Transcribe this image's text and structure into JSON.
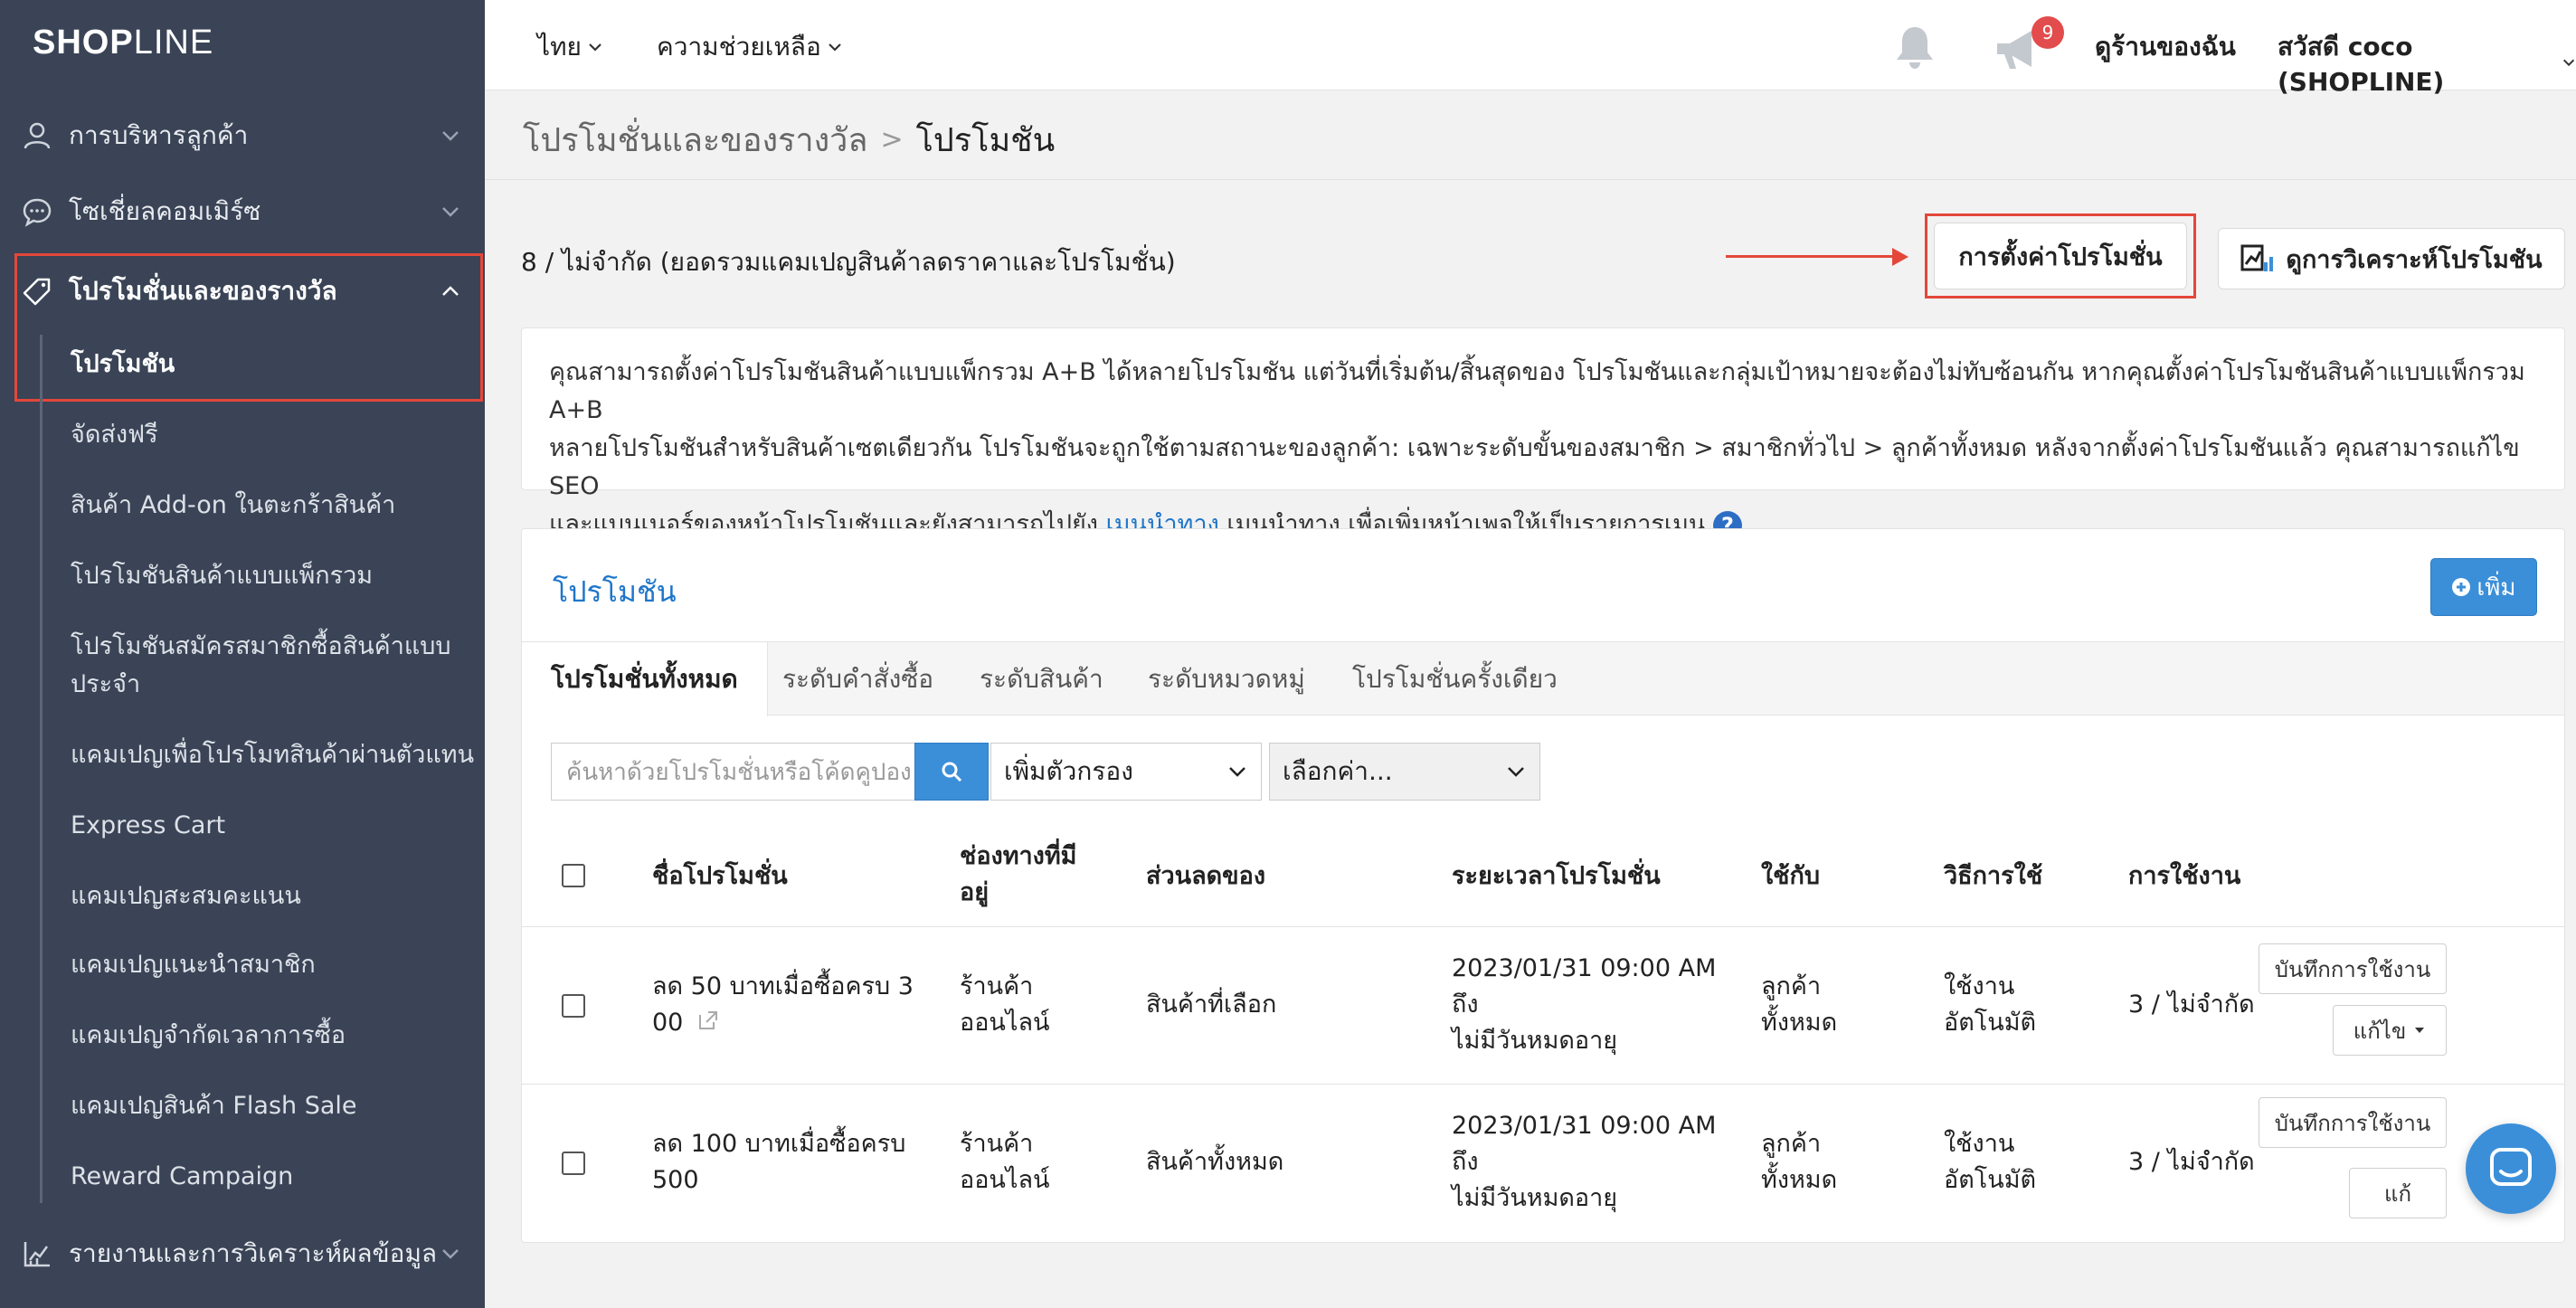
{
  "sidebar": {
    "logo_bold": "SHOP",
    "logo_thin": "LINE",
    "groups": [
      {
        "label": "การบริหารลูกค้า",
        "icon": "user-icon"
      },
      {
        "label": "โซเชี่ยลคอมเมิร์ซ",
        "icon": "chat-icon"
      },
      {
        "label": "โปรโมชั่นและของรางวัล",
        "icon": "tag-icon"
      },
      {
        "label": "รายงานและการวิเคราะห์ผลข้อมูล",
        "icon": "analytics-icon"
      }
    ],
    "sub_items": [
      "โปรโมชัน",
      "จัดส่งฟรี",
      "สินค้า Add-on ในตะกร้าสินค้า",
      "โปรโมชันสินค้าแบบแพ็กรวม",
      "โปรโมชันสมัครสมาชิกซื้อสินค้าแบบประจำ",
      "แคมเปญเพื่อโปรโมทสินค้าผ่านตัวแทน",
      "Express Cart",
      "แคมเปญสะสมคะแนน",
      "แคมเปญแนะนำสมาชิก",
      "แคมเปญจำกัดเวลาการซื้อ",
      "แคมเปญสินค้า Flash Sale",
      "Reward Campaign"
    ]
  },
  "topbar": {
    "language": "ไทย",
    "help": "ความช่วยเหลือ",
    "notification_count": "9",
    "view_store": "ดูร้านของฉัน",
    "greeting": "สวัสดี coco (SHOPLINE)"
  },
  "breadcrumb": {
    "parent": "โปรโมชั่นและของรางวัล",
    "separator": ">",
    "current": "โปรโมชัน"
  },
  "summary": {
    "quota": "8 / ไม่จำกัด (ยอดรวมแคมเปญสินค้าลดราคาและโปรโมชั่น)",
    "settings_button": "การตั้งค่าโปรโมชั่น",
    "analysis_button": "ดูการวิเคราะห์โปรโมชัน"
  },
  "info": {
    "line1": "คุณสามารถตั้งค่าโปรโมชันสินค้าแบบแพ็กรวม A+B ได้หลายโปรโมชัน แต่วันที่เริ่มต้น/สิ้นสุดของ โปรโมชันและกลุ่มเป้าหมายจะต้องไม่ทับซ้อนกัน หากคุณตั้งค่าโปรโมชันสินค้าแบบแพ็กรวม A+B",
    "line2": "หลายโปรโมชันสำหรับสินค้าเซตเดียวกัน โปรโมชันจะถูกใช้ตามสถานะของลูกค้า: เฉพาะระดับขั้นของสมาชิก > สมาชิกทั่วไป > ลูกค้าทั้งหมด หลังจากตั้งค่าโปรโมชันแล้ว คุณสามารถแก้ไข SEO",
    "line3_pre": "และแบนเนอร์ของหน้าโปรโมชันและยังสามารถไปยัง ",
    "line3_link": "เมนูนำทาง",
    "line3_post": " เมนูนำทาง เพื่อเพิ่มหน้าเพจให้เป็นรายการเมนู ",
    "help_mark": "?"
  },
  "panel": {
    "title": "โปรโมชัน",
    "add_button": "เพิ่ม",
    "tabs": [
      "โปรโมชั่นทั้งหมด",
      "ระดับคำสั่งซื้อ",
      "ระดับสินค้า",
      "ระดับหมวดหมู่",
      "โปรโมชั่นครั้งเดียว"
    ],
    "search_placeholder": "ค้นหาด้วยโปรโมชั่นหรือโค้ดคูปอง",
    "filter_select": "เพิ่มตัวกรอง",
    "value_select": "เลือกค่า...",
    "columns": {
      "name": "ชื่อโปรโมชั่น",
      "channel_1": "ช่องทางที่มี",
      "channel_2": "อยู่",
      "discount": "ส่วนลดของ",
      "period": "ระยะเวลาโปรโมชั่น",
      "applies": "ใช้กับ",
      "method": "วิธีการใช้",
      "usage": "การใช้งาน"
    },
    "rows": [
      {
        "name_1": "ลด 50 บาทเมื่อซื้อครบ 3",
        "name_2": "00",
        "channel_1": "ร้านค้า",
        "channel_2": "ออนไลน์",
        "discount": "สินค้าที่เลือก",
        "period_1": "2023/01/31 09:00 AM",
        "period_2": "ถึง",
        "period_3": "ไม่มีวันหมดอายุ",
        "applies_1": "ลูกค้า",
        "applies_2": "ทั้งหมด",
        "method_1": "ใช้งาน",
        "method_2": "อัตโนมัติ",
        "usage": "3 / ไม่จำกัด",
        "record_button": "บันทึกการใช้งาน",
        "edit_button": "แก้ไข"
      },
      {
        "name_1": "ลด 100 บาทเมื่อซื้อครบ",
        "name_2": "500",
        "channel_1": "ร้านค้า",
        "channel_2": "ออนไลน์",
        "discount": "สินค้าทั้งหมด",
        "period_1": "2023/01/31 09:00 AM",
        "period_2": "ถึง",
        "period_3": "ไม่มีวันหมดอายุ",
        "applies_1": "ลูกค้า",
        "applies_2": "ทั้งหมด",
        "method_1": "ใช้งาน",
        "method_2": "อัตโนมัติ",
        "usage": "3 / ไม่จำกัด",
        "record_button": "บันทึกการใช้งาน",
        "edit_button": "แก้"
      }
    ]
  },
  "colors": {
    "sidebar_bg": "#3a4456",
    "accent_blue": "#3b8fd9",
    "highlight_red": "#e4473a",
    "link_blue": "#1f76c9"
  }
}
